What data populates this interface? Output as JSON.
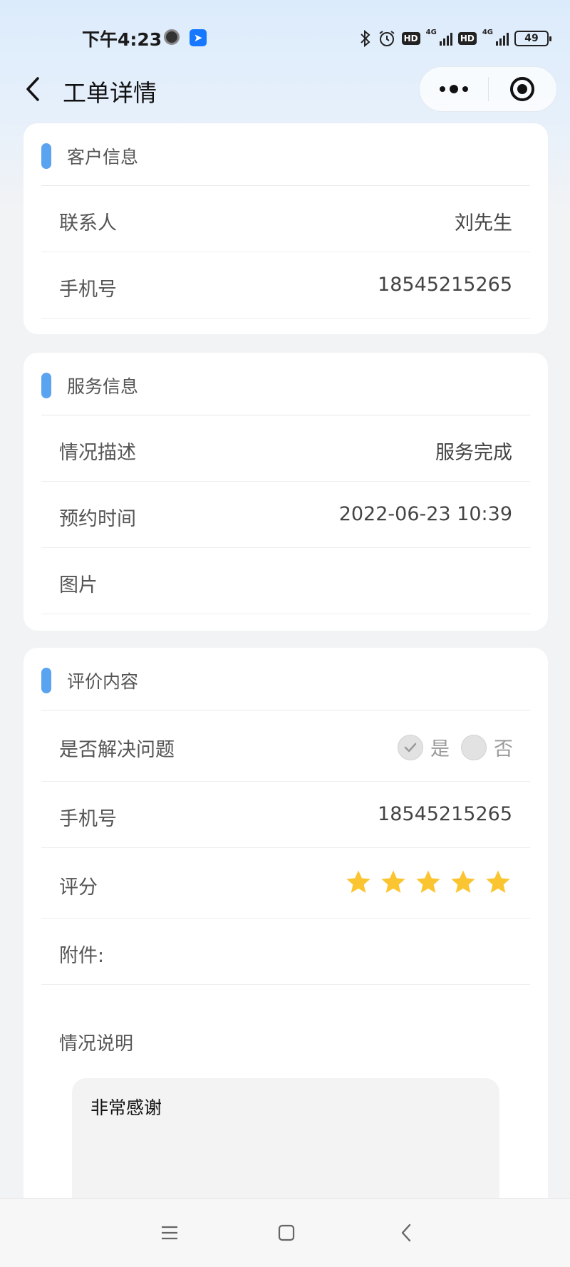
{
  "status_bar": {
    "time": "下午4:23",
    "network_1": "4G",
    "network_2": "4G",
    "hd_1": "HD",
    "hd_2": "HD",
    "battery": "49",
    "icons": [
      "clock-app-icon",
      "feishu-app-icon",
      "bluetooth-icon",
      "alarm-icon",
      "signal-icon",
      "battery-icon"
    ]
  },
  "nav": {
    "title": "工单详情",
    "back_icon": "chevron-left-icon",
    "more_icon": "more-dots-icon",
    "close_icon": "target-close-icon"
  },
  "customer_section": {
    "title": "客户信息",
    "rows": [
      {
        "label": "联系人",
        "value": "刘先生"
      },
      {
        "label": "手机号",
        "value": "18545215265"
      }
    ]
  },
  "service_section": {
    "title": "服务信息",
    "rows": [
      {
        "label": "情况描述",
        "value": "服务完成"
      },
      {
        "label": "预约时间",
        "value": "2022-06-23 10:39"
      },
      {
        "label": "图片",
        "value": ""
      }
    ]
  },
  "evaluation_section": {
    "title": "评价内容",
    "resolved": {
      "label": "是否解决问题",
      "options": [
        {
          "label": "是",
          "selected": true
        },
        {
          "label": "否",
          "selected": false
        }
      ]
    },
    "phone": {
      "label": "手机号",
      "value": "18545215265"
    },
    "rating": {
      "label": "评分",
      "value": 5,
      "max": 5
    },
    "attachment": {
      "label": "附件:"
    },
    "description": {
      "label": "情况说明",
      "text": "非常感谢"
    }
  },
  "colors": {
    "accent": "#5aa3f0",
    "star": "#fbc531",
    "header_gradient_top": "#dcebfb",
    "background": "#f2f3f5"
  },
  "system_nav": {
    "icons": [
      "menu-icon",
      "home-square-icon",
      "back-chevron-icon"
    ]
  }
}
